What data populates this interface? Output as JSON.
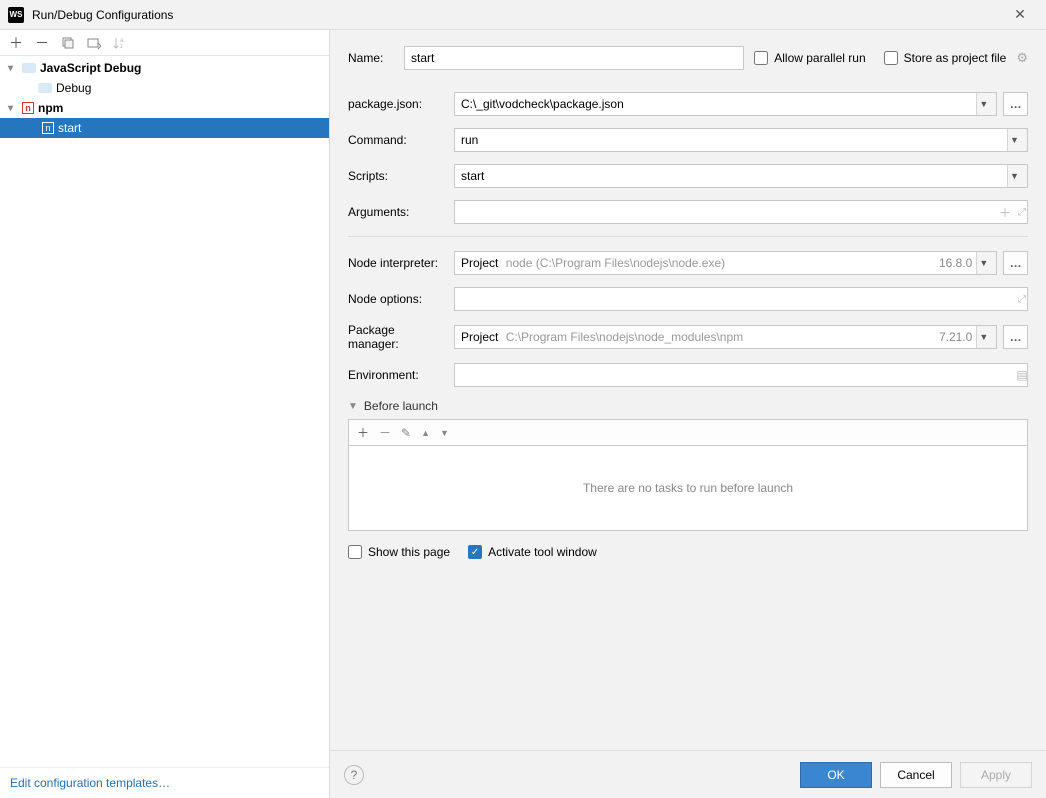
{
  "window": {
    "title": "Run/Debug Configurations"
  },
  "toolbar": {
    "add": "+",
    "remove": "−",
    "copy": "⿻"
  },
  "tree": {
    "items": [
      {
        "label": "JavaScript Debug"
      },
      {
        "label": "Debug"
      },
      {
        "label": "npm"
      },
      {
        "label": "start"
      }
    ]
  },
  "left_footer": {
    "templates_link": "Edit configuration templates…"
  },
  "form": {
    "name_label": "Name:",
    "name_value": "start",
    "allow_parallel_label": "Allow parallel run",
    "store_as_file_label": "Store as project file",
    "package_json_label": "package.json:",
    "package_json_value": "C:\\_git\\vodcheck\\package.json",
    "command_label": "Command:",
    "command_value": "run",
    "scripts_label": "Scripts:",
    "scripts_value": "start",
    "arguments_label": "Arguments:",
    "arguments_value": "",
    "node_interpreter_label": "Node interpreter:",
    "node_interpreter_prefix": "Project",
    "node_interpreter_path": "node (C:\\Program Files\\nodejs\\node.exe)",
    "node_interpreter_version": "16.8.0",
    "node_options_label": "Node options:",
    "node_options_value": "",
    "package_manager_label": "Package manager:",
    "package_manager_prefix": "Project",
    "package_manager_path": "C:\\Program Files\\nodejs\\node_modules\\npm",
    "package_manager_version": "7.21.0",
    "environment_label": "Environment:",
    "environment_value": ""
  },
  "before_launch": {
    "title": "Before launch",
    "empty_text": "There are no tasks to run before launch",
    "show_page_label": "Show this page",
    "activate_tool_label": "Activate tool window"
  },
  "footer": {
    "ok": "OK",
    "cancel": "Cancel",
    "apply": "Apply"
  }
}
